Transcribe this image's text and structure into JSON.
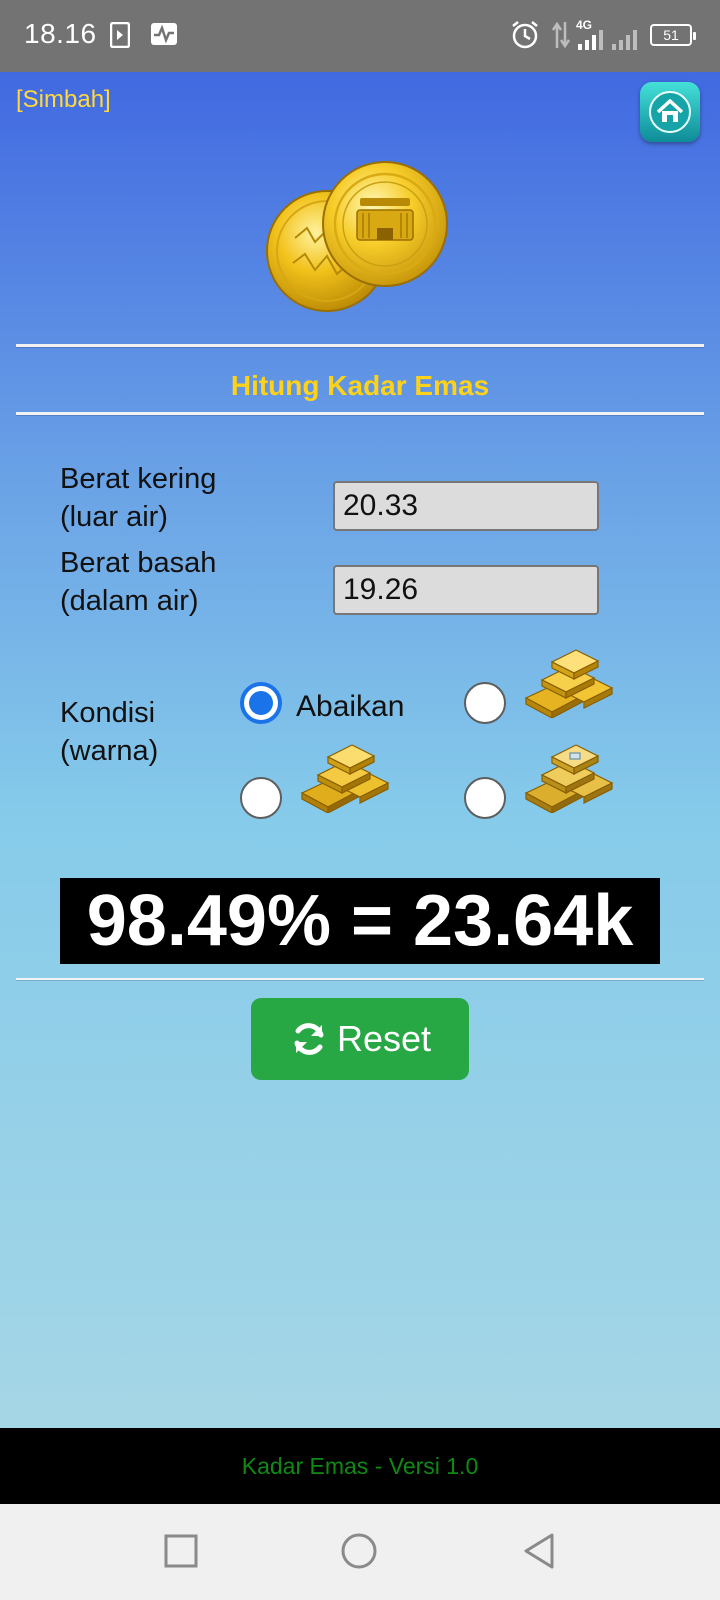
{
  "status_bar": {
    "time": "18.16",
    "network": "4G",
    "battery": "51"
  },
  "header": {
    "simbah_link": "[Simbah]",
    "home_icon": "home-icon"
  },
  "title": "Hitung Kadar Emas",
  "form": {
    "dry_weight": {
      "label_line1": "Berat kering",
      "label_line2": "(luar air)",
      "value": "20.33"
    },
    "wet_weight": {
      "label_line1": "Berat basah",
      "label_line2": "(dalam air)",
      "value": "19.26"
    },
    "condition": {
      "label_line1": "Kondisi",
      "label_line2": "(warna)",
      "options": [
        {
          "label": "Abaikan",
          "selected": true
        },
        {
          "icon": "gold-bars-icon",
          "selected": false
        },
        {
          "icon": "gold-bars-icon",
          "selected": false
        },
        {
          "icon": "gold-bars-icon",
          "selected": false
        }
      ]
    }
  },
  "result": "98.49% = 23.64k",
  "reset_button": {
    "label": "Reset",
    "icon": "refresh-icon"
  },
  "footer": "Kadar Emas - Versi 1.0",
  "colors": {
    "accent_yellow": "#ffd21a",
    "reset_green": "#28a745",
    "radio_blue": "#1a73e8",
    "footer_text": "#0e8a14"
  }
}
